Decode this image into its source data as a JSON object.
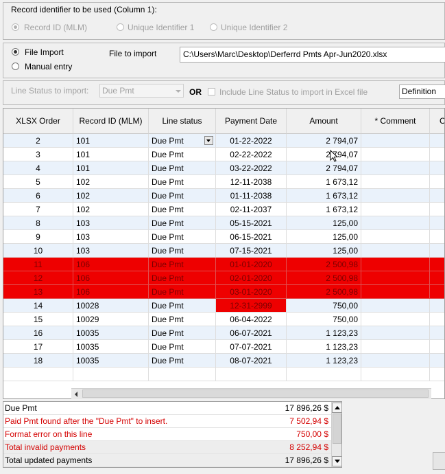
{
  "identifier": {
    "label": "Record identifier to be used (Column 1):",
    "options": [
      {
        "label": "Record ID (MLM)",
        "checked": true
      },
      {
        "label": "Unique Identifier 1",
        "checked": false
      },
      {
        "label": "Unique Identifier 2",
        "checked": false
      }
    ]
  },
  "source": {
    "file_import_label": "File Import",
    "manual_entry_label": "Manual entry",
    "file_to_import_label": "File to import",
    "file_path": "C:\\Users\\Marc\\Desktop\\Derferrd Pmts Apr-Jun2020.xlsx"
  },
  "status_bar": {
    "line_status_label": "Line Status to import:",
    "line_status_value": "Due Pmt",
    "or_label": "OR",
    "include_label": "Include Line Status to import in Excel file",
    "definition_value": "Definition"
  },
  "grid": {
    "headers": [
      "XLSX Order",
      "Record ID (MLM)",
      "Line status",
      "Payment Date",
      "Amount",
      "* Comment",
      "Cl"
    ],
    "rows": [
      {
        "order": "2",
        "rid": "101",
        "status": "Due Pmt",
        "date": "01-22-2022",
        "amount": "2 794,07"
      },
      {
        "order": "3",
        "rid": "101",
        "status": "Due Pmt",
        "date": "02-22-2022",
        "amount": "2 794,07"
      },
      {
        "order": "4",
        "rid": "101",
        "status": "Due Pmt",
        "date": "03-22-2022",
        "amount": "2 794,07"
      },
      {
        "order": "5",
        "rid": "102",
        "status": "Due Pmt",
        "date": "12-11-2038",
        "amount": "1 673,12"
      },
      {
        "order": "6",
        "rid": "102",
        "status": "Due Pmt",
        "date": "01-11-2038",
        "amount": "1 673,12"
      },
      {
        "order": "7",
        "rid": "102",
        "status": "Due Pmt",
        "date": "02-11-2037",
        "amount": "1 673,12"
      },
      {
        "order": "8",
        "rid": "103",
        "status": "Due Pmt",
        "date": "05-15-2021",
        "amount": "125,00"
      },
      {
        "order": "9",
        "rid": "103",
        "status": "Due Pmt",
        "date": "06-15-2021",
        "amount": "125,00"
      },
      {
        "order": "10",
        "rid": "103",
        "status": "Due Pmt",
        "date": "07-15-2021",
        "amount": "125,00"
      },
      {
        "order": "11",
        "rid": "106",
        "status": "Due Pmt",
        "date": "01-01-2020",
        "amount": "2 500,98"
      },
      {
        "order": "12",
        "rid": "106",
        "status": "Due Pmt",
        "date": "02-01-2020",
        "amount": "2 500,98"
      },
      {
        "order": "13",
        "rid": "106",
        "status": "Due Pmt",
        "date": "03-01-2020",
        "amount": "2 500,98"
      },
      {
        "order": "14",
        "rid": "10028",
        "status": "Due Pmt",
        "date": "12-31-2999",
        "amount": "750,00"
      },
      {
        "order": "15",
        "rid": "10029",
        "status": "Due Pmt",
        "date": "06-04-2022",
        "amount": "750,00"
      },
      {
        "order": "16",
        "rid": "10035",
        "status": "Due Pmt",
        "date": "06-07-2021",
        "amount": "1 123,23"
      },
      {
        "order": "17",
        "rid": "10035",
        "status": "Due Pmt",
        "date": "07-07-2021",
        "amount": "1 123,23"
      },
      {
        "order": "18",
        "rid": "10035",
        "status": "Due Pmt",
        "date": "08-07-2021",
        "amount": "1 123,23"
      }
    ],
    "error_rows": [
      9,
      10,
      11
    ],
    "error_cells": [
      {
        "row": 12,
        "col": "date"
      }
    ]
  },
  "summary": [
    {
      "label": "Due Pmt",
      "value": "17 896,26 $",
      "color": "#000000"
    },
    {
      "label": "Paid Pmt found after the \"Due Pmt\" to insert.",
      "value": "7 502,94 $",
      "color": "#d40000"
    },
    {
      "label": "Format error on this line",
      "value": "750,00 $",
      "color": "#d40000"
    },
    {
      "label": "Total invalid payments",
      "value": "8 252,94 $",
      "color": "#d40000"
    },
    {
      "label": "Total updated payments",
      "value": "17 896,26 $",
      "color": "#000000"
    }
  ],
  "colors": {
    "error_red": "#ee0000",
    "row_alt": "#eaf2fb"
  }
}
